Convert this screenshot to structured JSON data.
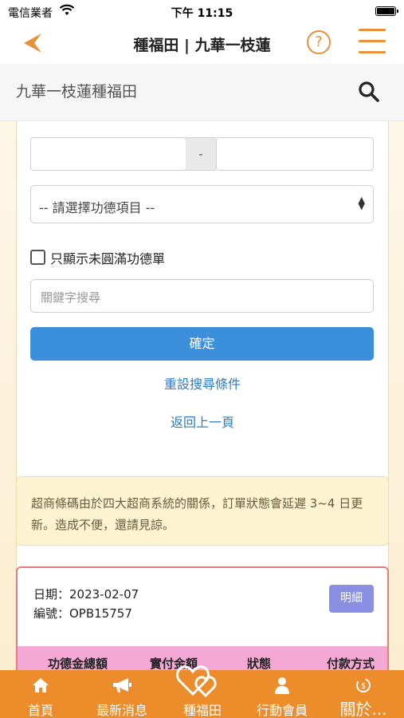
{
  "status": {
    "carrier": "電信業者",
    "time": "下午 11:15"
  },
  "nav": {
    "title": "種福田 | 九華一枝蓮",
    "help": "?"
  },
  "search": {
    "text": "九華一枝蓮種福田"
  },
  "form": {
    "range_separator": "-",
    "select_value": "-- 請選擇功德項目 --",
    "checkbox_label": "只顯示未圓滿功德單",
    "keyword_placeholder": "關鍵字搜尋",
    "confirm_label": "確定",
    "reset_link": "重設搜尋條件",
    "back_link": "返回上一頁"
  },
  "notice": {
    "text": "超商條碼由於四大超商系統的關係，訂單狀態會延遲 3~4 日更新。造成不便，還請見諒。"
  },
  "order": {
    "date": "日期：2023-02-07",
    "number": "編號：OPB15757",
    "detail_label": "明細",
    "columns": [
      "功德金總額",
      "實付金額",
      "狀態",
      "付款方式"
    ]
  },
  "tabs": [
    {
      "label": "首頁",
      "icon": "home-icon"
    },
    {
      "label": "最新消息",
      "icon": "megaphone-icon"
    },
    {
      "label": "種福田",
      "icon": "hearts-icon"
    },
    {
      "label": "行動會員",
      "icon": "person-icon"
    },
    {
      "label": "關於...",
      "icon": "about-icon"
    }
  ],
  "colors": {
    "accent": "#ec8c2a",
    "primary_button": "#3b8fdb",
    "link": "#2d7bc4",
    "detail_button": "#8a8fe3",
    "table_header": "#f4a8d6"
  }
}
